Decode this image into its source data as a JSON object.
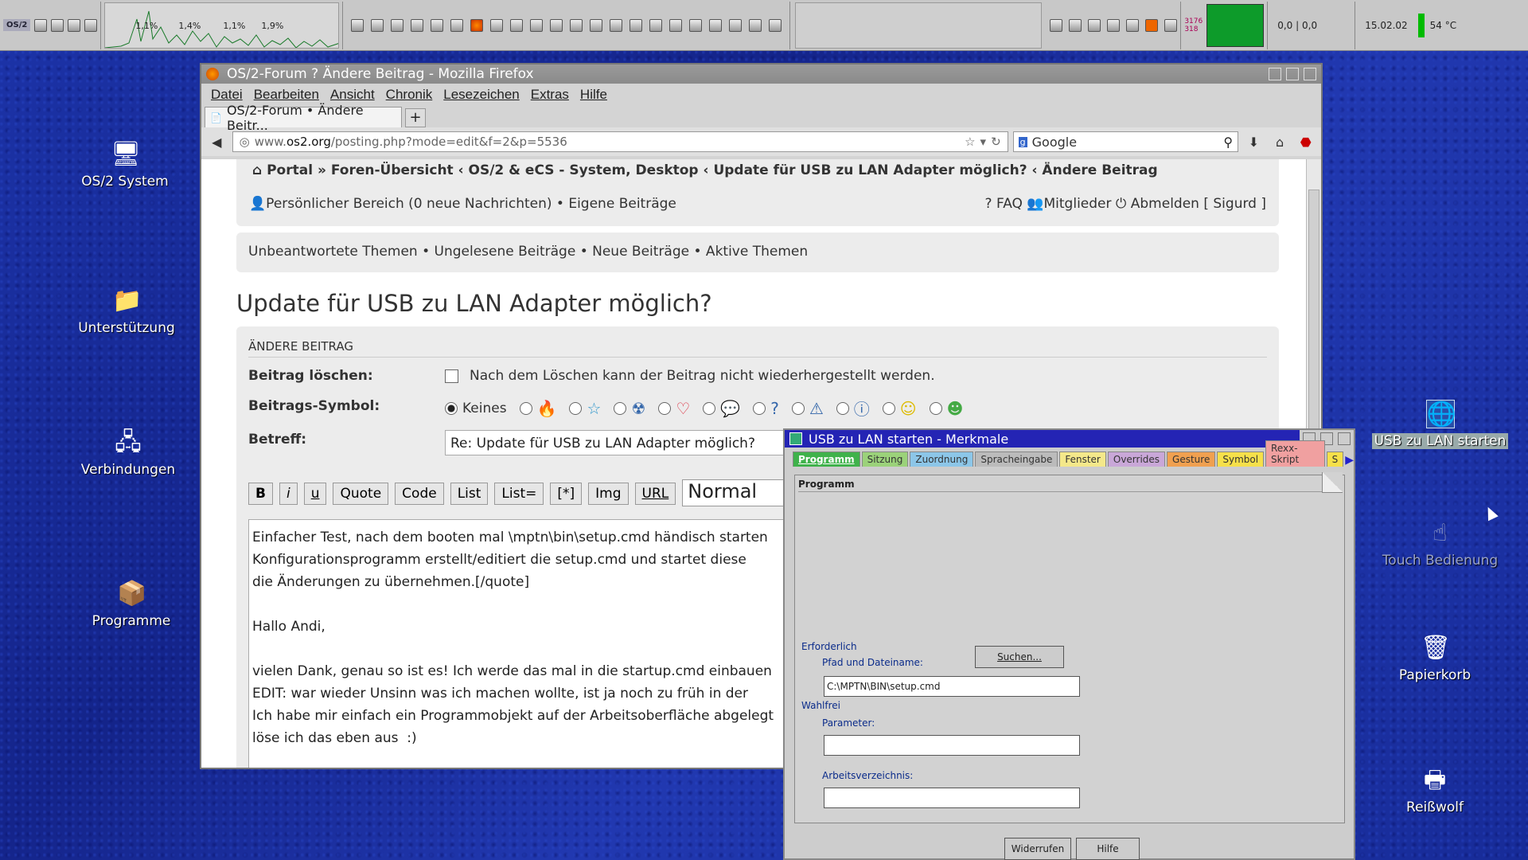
{
  "taskbar": {
    "logo": "OS/2",
    "cpu_values": [
      "1,1%",
      "1,4%",
      "1,1%",
      "1,9%"
    ],
    "counts": [
      "3176",
      "318"
    ],
    "coords": "0,0 | 0,0",
    "date": "15.02.02",
    "temp": "54 °C"
  },
  "desktop": {
    "icons": [
      {
        "label": "OS/2 System",
        "glyph": "computer-icon"
      },
      {
        "label": "Unterstützung",
        "glyph": "help-folder-icon"
      },
      {
        "label": "Verbindungen",
        "glyph": "network-icon"
      },
      {
        "label": "Programme",
        "glyph": "programs-icon"
      },
      {
        "label": "USB zu LAN starten",
        "glyph": "program-object-icon"
      },
      {
        "label": "Touch Bedienung",
        "glyph": "touch-icon"
      },
      {
        "label": "Papierkorb",
        "glyph": "trash-icon"
      },
      {
        "label": "Reißwolf",
        "glyph": "shredder-icon"
      }
    ]
  },
  "browser": {
    "title": "OS/2-Forum ? Ändere Beitrag - Mozilla Firefox",
    "menu": [
      "Datei",
      "Bearbeiten",
      "Ansicht",
      "Chronik",
      "Lesezeichen",
      "Extras",
      "Hilfe"
    ],
    "tab_label": "OS/2-Forum • Ändere Beitr...",
    "tab_plus": "+",
    "url_host": "www.os2.org",
    "url_prefix": "www.",
    "url_domain": "os2.org",
    "url_path": "/posting.php?mode=edit&f=2&p=5536",
    "search_placeholder": "Google"
  },
  "forum": {
    "breadcrumb": "Portal » Foren-Übersicht ‹ OS/2 & eCS - System, Desktop ‹ Update für USB zu LAN Adapter möglich? ‹ Ändere Beitrag",
    "user_left": "Persönlicher Bereich (0 neue Nachrichten) • Eigene Beiträge",
    "faq": "FAQ",
    "members": "Mitglieder",
    "logout": "Abmelden [ Sigurd ]",
    "quicklinks": "Unbeantwortete Themen • Ungelesene Beiträge • Neue Beiträge • Aktive Themen",
    "topic_title": "Update für USB zu LAN Adapter möglich?",
    "form_header": "ÄNDERE BEITRAG",
    "delete_label": "Beitrag löschen:",
    "delete_text": "Nach dem Löschen kann der Beitrag nicht wiederhergestellt werden.",
    "symbol_label": "Beitrags-Symbol:",
    "symbol_none": "Keines",
    "subject_label": "Betreff:",
    "subject_value": "Re: Update für USB zu LAN Adapter möglich?",
    "toolbar": [
      "B",
      "i",
      "u",
      "Quote",
      "Code",
      "List",
      "List=",
      "[*]",
      "Img",
      "URL"
    ],
    "font_size": "Normal",
    "message": "Einfacher Test, nach dem booten mal \\mptn\\bin\\setup.cmd händisch starten\nKonfigurationsprogramm erstellt/editiert die setup.cmd und startet diese\ndie Änderungen zu übernehmen.[/quote]\n\nHallo Andi,\n\nvielen Dank, genau so ist es! Ich werde das mal in die startup.cmd einbauen\nEDIT: war wieder Unsinn was ich machen wollte, ist ja noch zu früh in der\nIch habe mir einfach ein Programmobjekt auf der Arbeitsoberfläche abgelegt\nlöse ich das eben aus  :)"
  },
  "dialog": {
    "title": "USB zu LAN starten - Merkmale",
    "tabs": [
      "Programm",
      "Sitzung",
      "Zuordnung",
      "Spracheingabe",
      "Fenster",
      "Overrides",
      "Gesture",
      "Symbol",
      "Rexx-Skript",
      "S"
    ],
    "page_title": "Programm",
    "required": "Erforderlich",
    "path_label": "Pfad und Dateiname:",
    "search_btn": "Suchen...",
    "path_value": "C:\\MPTN\\BIN\\setup.cmd",
    "optional": "Wahlfrei",
    "params_label": "Parameter:",
    "params_value": "",
    "workdir_label": "Arbeitsverzeichnis:",
    "workdir_value": "",
    "undo_btn": "Widerrufen",
    "help_btn": "Hilfe"
  }
}
